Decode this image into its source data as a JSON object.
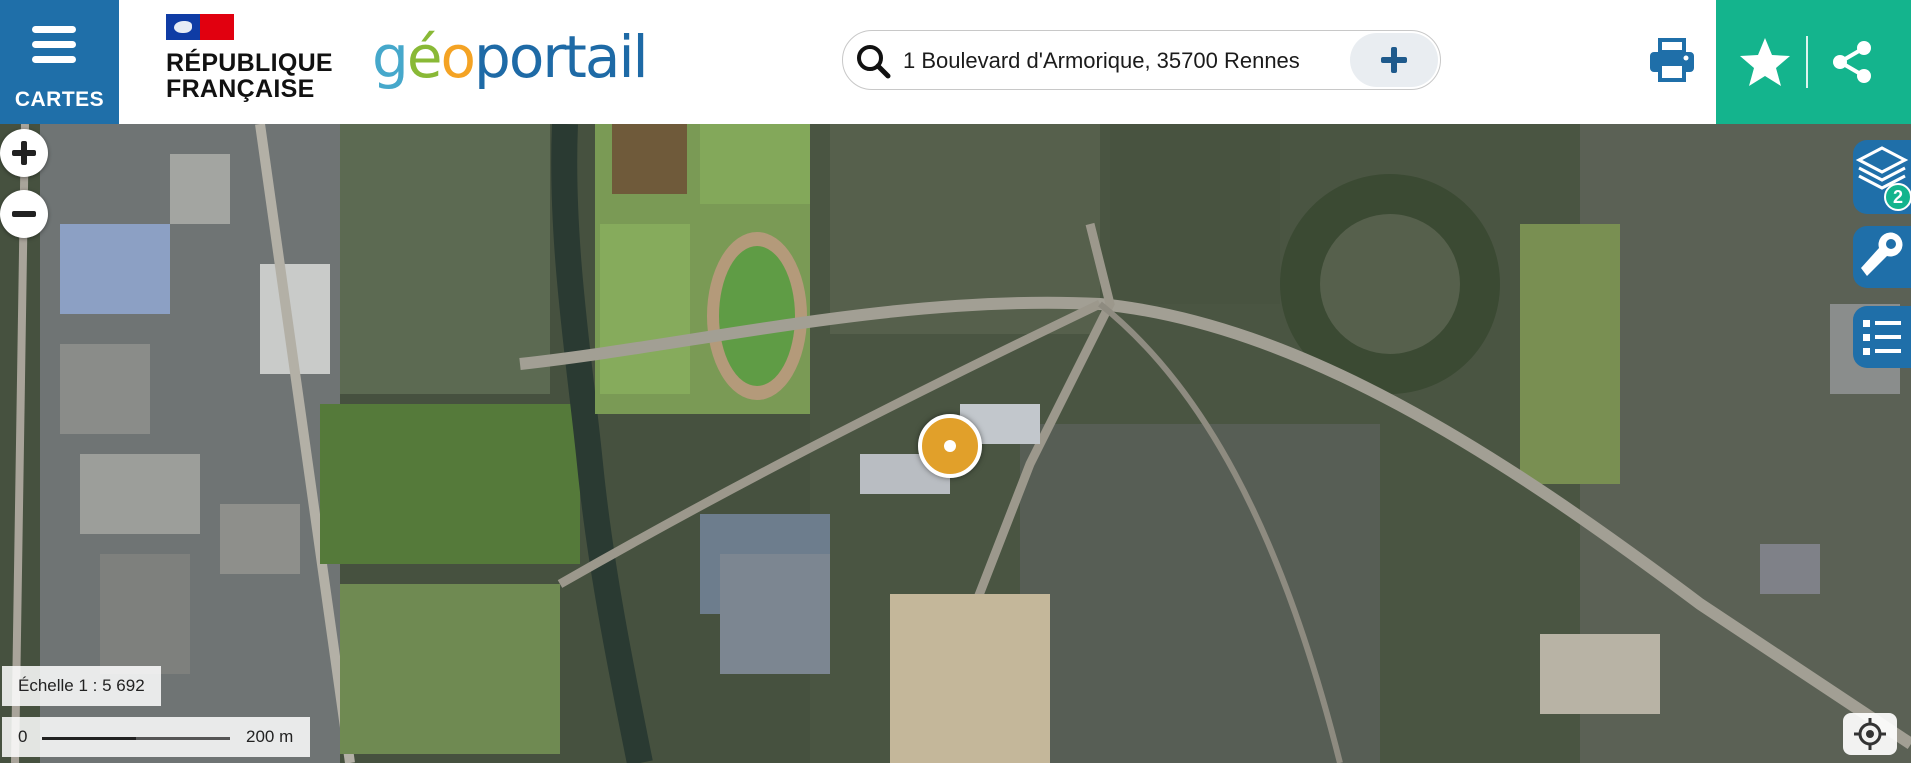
{
  "header": {
    "menu": {
      "label": "CARTES",
      "icon": "hamburger-menu-icon"
    },
    "republique": {
      "line1": "RÉPUBLIQUE",
      "line2": "FRANÇAISE",
      "icon": "marianne-flag-icon"
    },
    "logo": {
      "part1": "g",
      "part2": "é",
      "part3": "o",
      "part4": "portail"
    },
    "search": {
      "value": "1 Boulevard d'Armorique, 35700 Rennes",
      "icon": "search-icon",
      "add_icon": "plus-icon"
    },
    "actions": {
      "print_icon": "printer-icon",
      "favorite_icon": "star-icon",
      "share_icon": "share-icon"
    },
    "colors": {
      "brand_blue": "#1f6fa9",
      "teal": "#14b48d",
      "marker": "#e1a02a"
    }
  },
  "map": {
    "zoom_in_icon": "plus-icon",
    "zoom_out_icon": "minus-icon",
    "layers": {
      "icon": "layers-icon",
      "count": "2"
    },
    "tools_icon": "wrench-icon",
    "legend_icon": "checklist-icon",
    "scale": {
      "label": "Échelle 1 : 5 692",
      "min": "0",
      "max": "200 m"
    },
    "locate_icon": "crosshair-icon"
  }
}
